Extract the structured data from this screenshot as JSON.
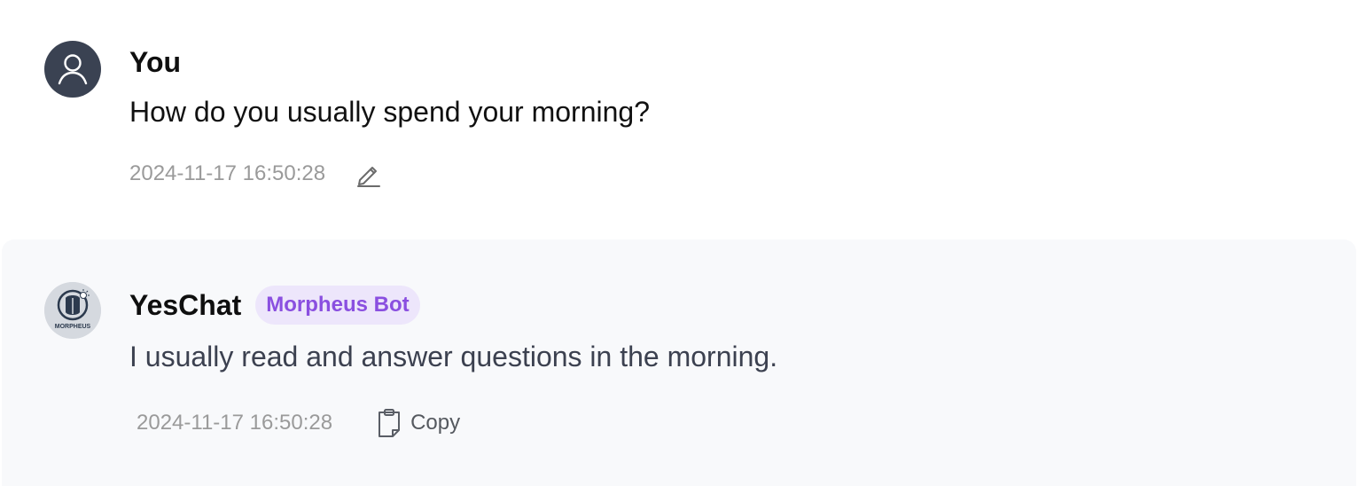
{
  "messages": {
    "user": {
      "name": "You",
      "text": "How do you usually spend your morning?",
      "timestamp": "2024-11-17 16:50:28",
      "avatar_icon": "user-icon",
      "edit_icon": "pencil-icon"
    },
    "bot": {
      "name": "YesChat",
      "badge": "Morpheus Bot",
      "text": "I usually read and answer questions in the morning.",
      "timestamp": "2024-11-17 16:50:28",
      "copy_label": "Copy",
      "avatar_icon": "morpheus-logo",
      "avatar_logo_text": "MORPHEUS",
      "copy_icon": "clipboard-icon"
    }
  },
  "colors": {
    "user_avatar_bg": "#3a4252",
    "bot_row_bg": "#f8f9fb",
    "badge_bg": "#ede6fb",
    "badge_text": "#8a4fe0",
    "timestamp": "#9a9a9a"
  }
}
